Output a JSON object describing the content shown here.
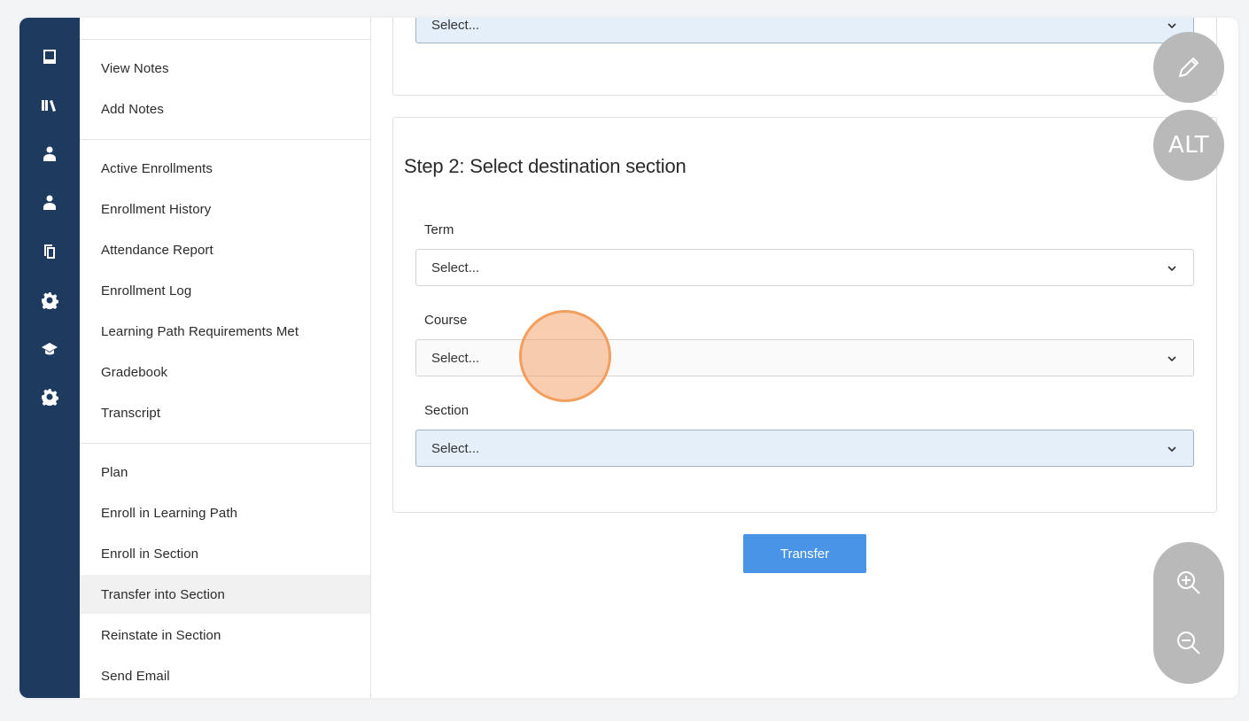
{
  "subnav": {
    "group1": [
      {
        "label": "View Notes"
      },
      {
        "label": "Add Notes"
      }
    ],
    "group2": [
      {
        "label": "Active Enrollments"
      },
      {
        "label": "Enrollment History"
      },
      {
        "label": "Attendance Report"
      },
      {
        "label": "Enrollment Log"
      },
      {
        "label": "Learning Path Requirements Met"
      },
      {
        "label": "Gradebook"
      },
      {
        "label": "Transcript"
      }
    ],
    "group3": [
      {
        "label": "Plan"
      },
      {
        "label": "Enroll in Learning Path"
      },
      {
        "label": "Enroll in Section"
      },
      {
        "label": "Transfer into Section",
        "active": true
      },
      {
        "label": "Reinstate in Section"
      },
      {
        "label": "Send Email"
      }
    ]
  },
  "step1": {
    "select_value": "Select..."
  },
  "step2": {
    "title": "Step 2: Select destination section",
    "term_label": "Term",
    "term_value": "Select...",
    "course_label": "Course",
    "course_value": "Select...",
    "section_label": "Section",
    "section_value": "Select..."
  },
  "actions": {
    "transfer_label": "Transfer"
  },
  "overlay": {
    "alt_label": "ALT"
  },
  "colors": {
    "rail": "#1e3a5f",
    "primary_button": "#4a94e8",
    "focused_select": "#e4eff9",
    "cursor": "#f4a46e"
  }
}
